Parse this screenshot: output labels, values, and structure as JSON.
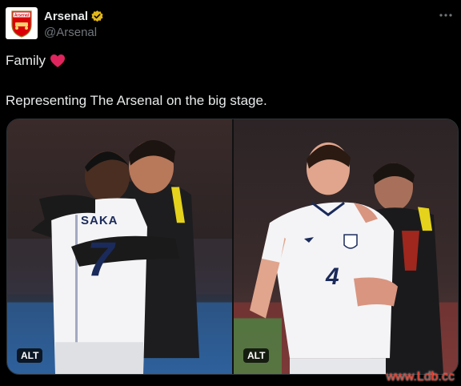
{
  "account": {
    "display_name": "Arsenal",
    "handle": "@Arsenal",
    "verified_icon": "verified-badge-icon",
    "brand_color": "#db0007",
    "verified_color": "#e2b719"
  },
  "tweet": {
    "line1": "Family",
    "line2": "Representing The Arsenal on the big stage.",
    "heart_color": "#f91880"
  },
  "media": {
    "left": {
      "jersey_name": "SAKA",
      "jersey_number": "7",
      "alt_label": "ALT"
    },
    "right": {
      "jersey_number": "4",
      "alt_label": "ALT"
    }
  },
  "watermark": "www.Ldb.cc",
  "menu_icon": "more-icon"
}
